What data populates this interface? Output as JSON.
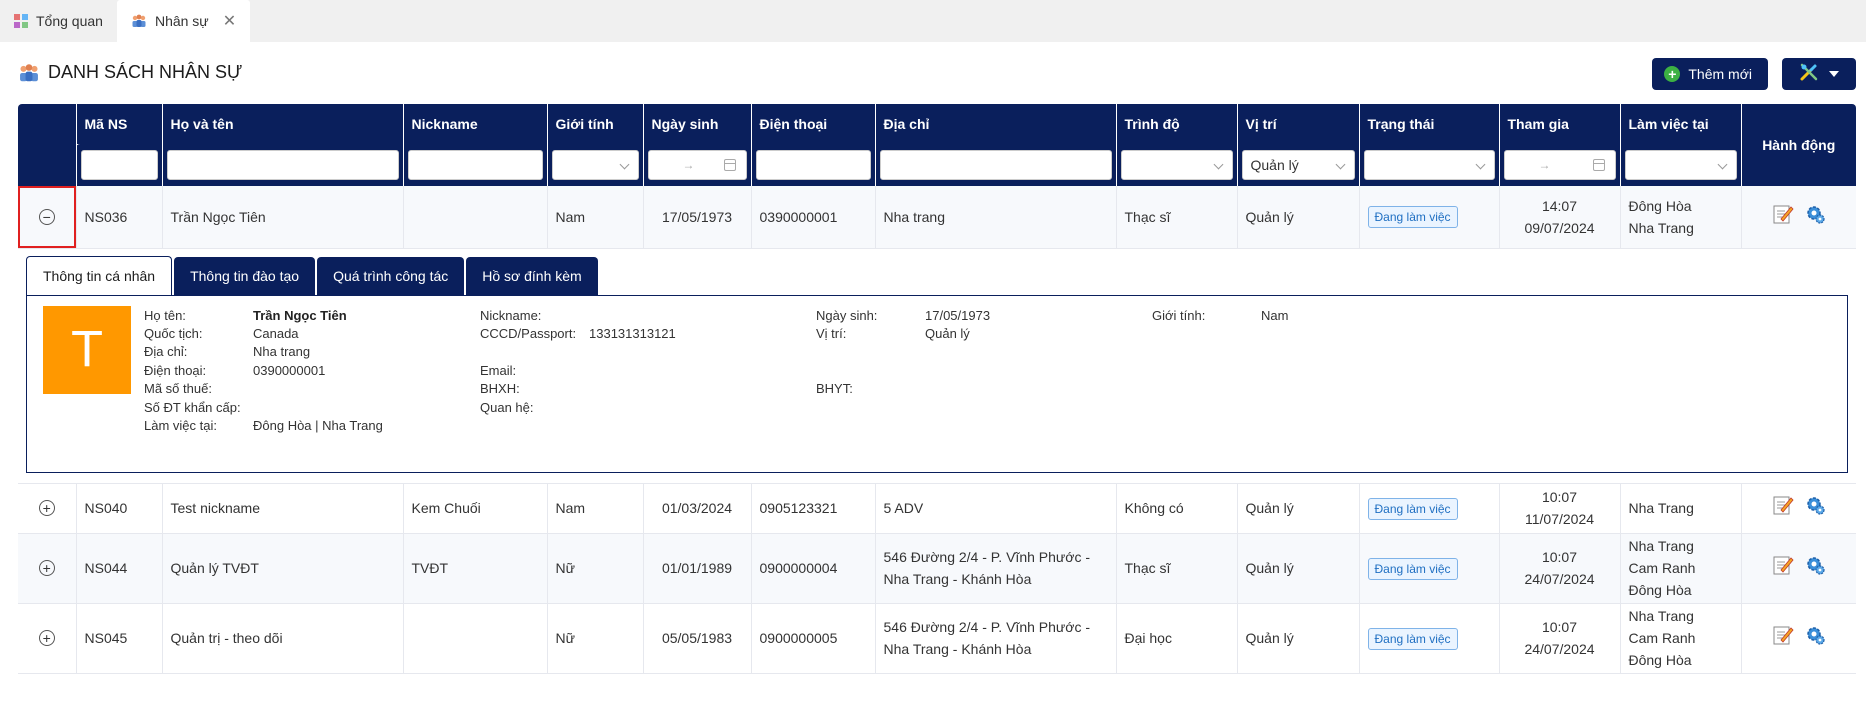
{
  "tabs": [
    {
      "label": "Tổng quan",
      "icon": "dashboard-icon"
    },
    {
      "label": "Nhân sự",
      "icon": "people-icon",
      "active": true
    }
  ],
  "header": {
    "title": "DANH SÁCH NHÂN SỰ",
    "add_label": "Thêm mới"
  },
  "columns": {
    "code": "Mã NS",
    "name": "Họ và tên",
    "nickname": "Nickname",
    "gender": "Giới tính",
    "birth": "Ngày sinh",
    "phone": "Điện thoại",
    "address": "Địa chỉ",
    "level": "Trình độ",
    "position": "Vị trí",
    "status": "Trạng thái",
    "joined": "Tham gia",
    "workplace": "Làm việc tại",
    "actions": "Hành động"
  },
  "filters": {
    "position_value": "Quản lý",
    "date_arrow": "→"
  },
  "rows": [
    {
      "code": "NS036",
      "name": "Trần Ngọc Tiên",
      "nickname": "",
      "gender": "Nam",
      "birth": "17/05/1973",
      "phone": "0390000001",
      "address": "Nha trang",
      "level": "Thạc sĩ",
      "position": "Quản lý",
      "status": "Đang làm việc",
      "joined_time": "14:07",
      "joined_date": "09/07/2024",
      "workplace": [
        "Đông Hòa",
        "Nha Trang"
      ],
      "expanded": true
    },
    {
      "code": "NS040",
      "name": "Test nickname",
      "nickname": "Kem Chuối",
      "gender": "Nam",
      "birth": "01/03/2024",
      "phone": "0905123321",
      "address": "5 ADV",
      "level": "Không có",
      "position": "Quản lý",
      "status": "Đang làm việc",
      "joined_time": "10:07",
      "joined_date": "11/07/2024",
      "workplace": [
        "Nha Trang"
      ]
    },
    {
      "code": "NS044",
      "name": "Quản lý TVĐT",
      "nickname": "TVĐT",
      "gender": "Nữ",
      "birth": "01/01/1989",
      "phone": "0900000004",
      "address": "546 Đường 2/4 - P. Vĩnh Phước - Nha Trang - Khánh Hòa",
      "level": "Thạc sĩ",
      "position": "Quản lý",
      "status": "Đang làm việc",
      "joined_time": "10:07",
      "joined_date": "24/07/2024",
      "workplace": [
        "Nha Trang",
        "Cam Ranh",
        "Đông Hòa"
      ]
    },
    {
      "code": "NS045",
      "name": "Quản trị - theo dõi",
      "nickname": "",
      "gender": "Nữ",
      "birth": "05/05/1983",
      "phone": "0900000005",
      "address": "546 Đường 2/4 - P. Vĩnh Phước - Nha Trang - Khánh Hòa",
      "level": "Đại học",
      "position": "Quản lý",
      "status": "Đang làm việc",
      "joined_time": "10:07",
      "joined_date": "24/07/2024",
      "workplace": [
        "Nha Trang",
        "Cam Ranh",
        "Đông Hòa"
      ]
    }
  ],
  "detail": {
    "tabs": [
      "Thông tin cá nhân",
      "Thông tin đào tạo",
      "Quá trình công tác",
      "Hồ sơ đính kèm"
    ],
    "avatar_letter": "T",
    "labels": {
      "fullname": "Họ tên:",
      "nationality": "Quốc tịch:",
      "address": "Địa chỉ:",
      "phone": "Điện thoại:",
      "tax": "Mã số thuế:",
      "emergency": "Số ĐT khẩn cấp:",
      "workplace": "Làm việc tại:",
      "nickname": "Nickname:",
      "idcard": "CCCD/Passport:",
      "email": "Email:",
      "bhxh": "BHXH:",
      "relation": "Quan hệ:",
      "birth": "Ngày sinh:",
      "position": "Vị trí:",
      "bhyt": "BHYT:",
      "gender": "Giới tính:"
    },
    "values": {
      "fullname": "Trần Ngọc Tiên",
      "nationality": "Canada",
      "address": "Nha trang",
      "phone": "0390000001",
      "workplace": "Đông Hòa | Nha Trang",
      "idcard": "133131313121",
      "birth": "17/05/1973",
      "position": "Quản lý",
      "gender": "Nam"
    }
  }
}
